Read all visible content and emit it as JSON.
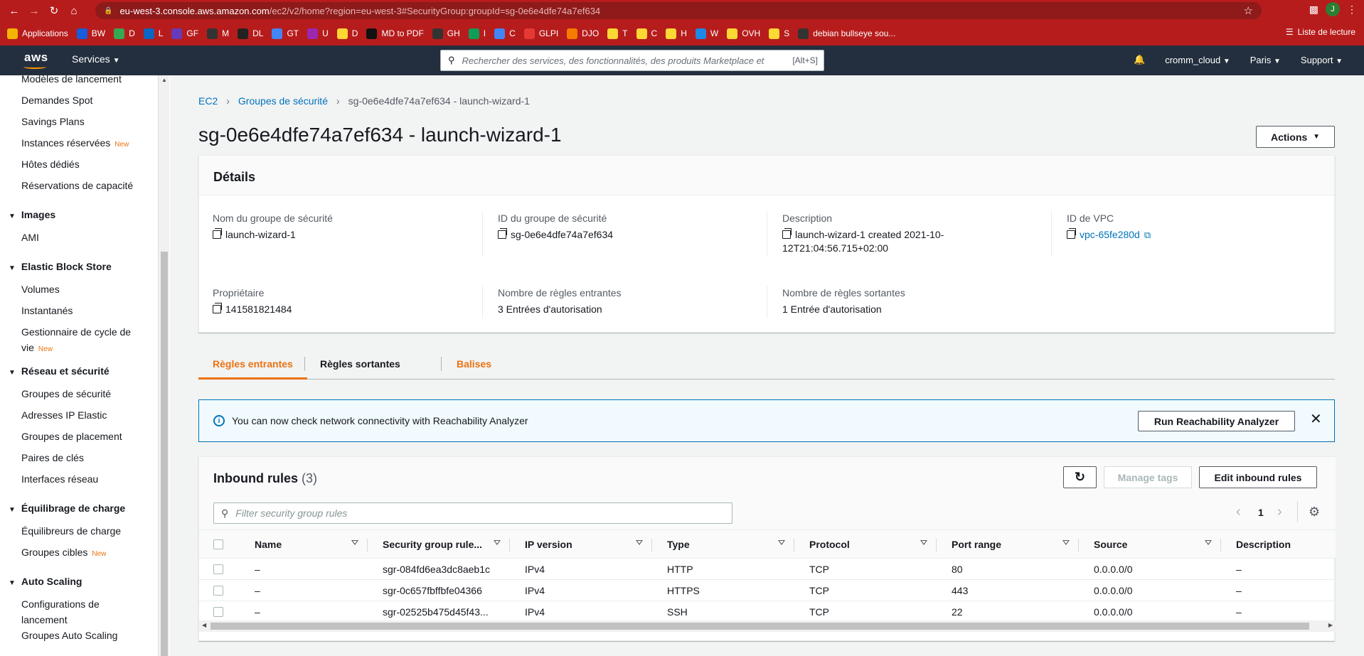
{
  "browser": {
    "url_host": "eu-west-3.console.aws.amazon.com",
    "url_path": "/ec2/v2/home?region=eu-west-3#SecurityGroup:groupId=sg-0e6e4dfe74a7ef634",
    "avatar_letter": "J",
    "bookmarks": [
      {
        "label": "Applications",
        "icon": "apps-grid-icon",
        "color": "#f4b400"
      },
      {
        "label": "BW",
        "icon": "shield-icon",
        "color": "#175ddc"
      },
      {
        "label": "D",
        "icon": "drive-icon",
        "color": "#34a853"
      },
      {
        "label": "L",
        "icon": "linkedin-icon",
        "color": "#0a66c2"
      },
      {
        "label": "GF",
        "icon": "forms-icon",
        "color": "#673ab7"
      },
      {
        "label": "M",
        "icon": "m-icon",
        "color": "#333333"
      },
      {
        "label": "DL",
        "icon": "hex-icon",
        "color": "#222222"
      },
      {
        "label": "GT",
        "icon": "translate-icon",
        "color": "#4285f4"
      },
      {
        "label": "U",
        "icon": "u-icon",
        "color": "#9c27b0"
      },
      {
        "label": "D",
        "icon": "note-icon",
        "color": "#fdd835"
      },
      {
        "label": "MD to PDF",
        "icon": "md-icon",
        "color": "#111111"
      },
      {
        "label": "GH",
        "icon": "github-icon",
        "color": "#333333"
      },
      {
        "label": "I",
        "icon": "plus-icon",
        "color": "#0f9d58"
      },
      {
        "label": "C",
        "icon": "calendar-icon",
        "color": "#4285f4"
      },
      {
        "label": "GLPI",
        "icon": "glpi-icon",
        "color": "#e53935"
      },
      {
        "label": "DJO",
        "icon": "radiation-icon",
        "color": "#f57c00"
      },
      {
        "label": "T",
        "icon": "note-icon",
        "color": "#fdd835"
      },
      {
        "label": "C",
        "icon": "note-icon",
        "color": "#fdd835"
      },
      {
        "label": "H",
        "icon": "note-icon",
        "color": "#fdd835"
      },
      {
        "label": "W",
        "icon": "mail-icon",
        "color": "#1e88e5"
      },
      {
        "label": "OVH",
        "icon": "note-icon",
        "color": "#fdd835"
      },
      {
        "label": "S",
        "icon": "note-icon",
        "color": "#fdd835"
      },
      {
        "label": "debian bullseye sou...",
        "icon": "github-icon",
        "color": "#333333"
      }
    ],
    "reading_list": "Liste de lecture"
  },
  "aws_nav": {
    "logo": "aws",
    "services": "Services",
    "search_placeholder": "Rechercher des services, des fonctionnalités, des produits Marketplace et",
    "search_shortcut": "[Alt+S]",
    "account": "cromm_cloud",
    "region": "Paris",
    "support": "Support"
  },
  "sidebar": {
    "items": [
      {
        "label": "Modèles de lancement",
        "new": ""
      },
      {
        "label": "Demandes Spot",
        "new": ""
      },
      {
        "label": "Savings Plans",
        "new": ""
      },
      {
        "label": "Instances réservées",
        "new": "New"
      },
      {
        "label": "Hôtes dédiés",
        "new": ""
      },
      {
        "label": "Réservations de capacité",
        "new": ""
      }
    ],
    "sections": [
      {
        "title": "Images",
        "items": [
          {
            "label": "AMI",
            "new": ""
          }
        ]
      },
      {
        "title": "Elastic Block Store",
        "items": [
          {
            "label": "Volumes",
            "new": ""
          },
          {
            "label": "Instantanés",
            "new": ""
          },
          {
            "label": "Gestionnaire de cycle de",
            "label2": "vie",
            "new": "New"
          }
        ]
      },
      {
        "title": "Réseau et sécurité",
        "items": [
          {
            "label": "Groupes de sécurité",
            "new": ""
          },
          {
            "label": "Adresses IP Elastic",
            "new": ""
          },
          {
            "label": "Groupes de placement",
            "new": ""
          },
          {
            "label": "Paires de clés",
            "new": ""
          },
          {
            "label": "Interfaces réseau",
            "new": ""
          }
        ]
      },
      {
        "title": "Équilibrage de charge",
        "items": [
          {
            "label": "Équilibreurs de charge",
            "new": ""
          },
          {
            "label": "Groupes cibles",
            "new": "New"
          }
        ]
      },
      {
        "title": "Auto Scaling",
        "items": [
          {
            "label": "Configurations de",
            "label2": "lancement",
            "new": ""
          },
          {
            "label": "Groupes Auto Scaling",
            "new": ""
          }
        ]
      }
    ]
  },
  "breadcrumb": {
    "items": [
      "EC2",
      "Groupes de sécurité",
      "sg-0e6e4dfe74a7ef634 - launch-wizard-1"
    ]
  },
  "page": {
    "title": "sg-0e6e4dfe74a7ef634 - launch-wizard-1",
    "actions": "Actions"
  },
  "details": {
    "header": "Détails",
    "fields": [
      {
        "label": "Nom du groupe de sécurité",
        "value": "launch-wizard-1"
      },
      {
        "label": "ID du groupe de sécurité",
        "value": "sg-0e6e4dfe74a7ef634"
      },
      {
        "label": "Description",
        "value": "launch-wizard-1 created 2021-10-",
        "value2": "12T21:04:56.715+02:00"
      },
      {
        "label": "ID de VPC",
        "value": "vpc-65fe280d"
      },
      {
        "label": "Propriétaire",
        "value": "141581821484"
      },
      {
        "label": "Nombre de règles entrantes",
        "value": "3 Entrées d'autorisation"
      },
      {
        "label": "Nombre de règles sortantes",
        "value": "1 Entrée d'autorisation"
      }
    ]
  },
  "tabs": [
    "Règles entrantes",
    "Règles sortantes",
    "Balises"
  ],
  "banner": {
    "text": "You can now check network connectivity with Reachability Analyzer",
    "button": "Run Reachability Analyzer"
  },
  "inbound": {
    "title": "Inbound rules",
    "count": "(3)",
    "manage_tags": "Manage tags",
    "edit": "Edit inbound rules",
    "filter_placeholder": "Filter security group rules",
    "page": "1",
    "columns": [
      "Name",
      "Security group rule...",
      "IP version",
      "Type",
      "Protocol",
      "Port range",
      "Source",
      "Description"
    ],
    "rows": [
      {
        "name": "–",
        "rule": "sgr-084fd6ea3dc8aeb1c",
        "ip": "IPv4",
        "type": "HTTP",
        "protocol": "TCP",
        "port": "80",
        "source": "0.0.0.0/0",
        "desc": "–"
      },
      {
        "name": "–",
        "rule": "sgr-0c657fbffbfe04366",
        "ip": "IPv4",
        "type": "HTTPS",
        "protocol": "TCP",
        "port": "443",
        "source": "0.0.0.0/0",
        "desc": "–"
      },
      {
        "name": "–",
        "rule": "sgr-02525b475d45f43...",
        "ip": "IPv4",
        "type": "SSH",
        "protocol": "TCP",
        "port": "22",
        "source": "0.0.0.0/0",
        "desc": "–"
      }
    ]
  }
}
